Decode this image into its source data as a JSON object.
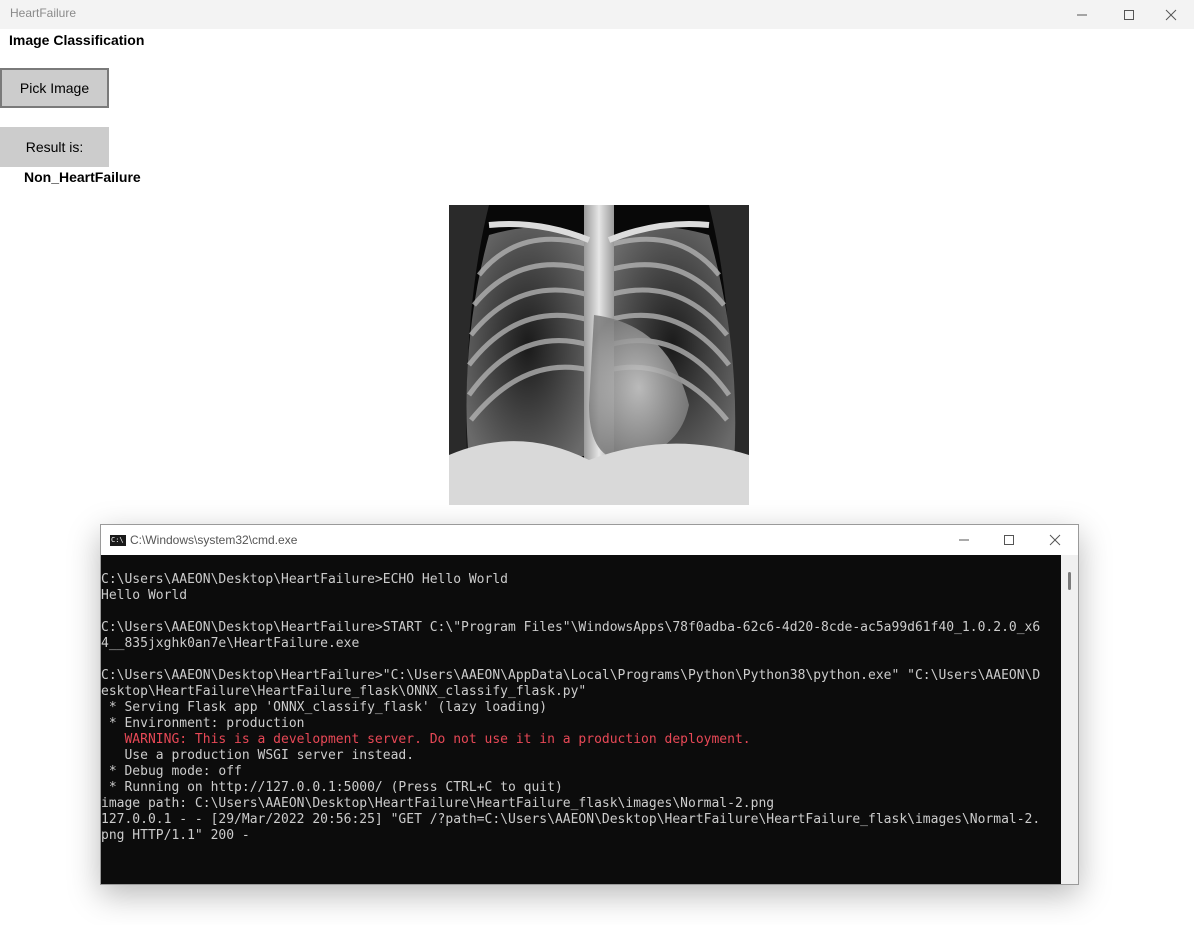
{
  "app": {
    "title": "HeartFailure",
    "heading": "Image Classification",
    "pick_button_label": "Pick Image",
    "result_label": "Result is:",
    "result_value": "Non_HeartFailure"
  },
  "icons": {
    "minimize": "minimize-icon",
    "maximize": "maximize-icon",
    "close": "close-icon",
    "console": "console-icon"
  },
  "cmd": {
    "title": "C:\\Windows\\system32\\cmd.exe",
    "icon_text": "C:\\",
    "lines": [
      {
        "text": "C:\\Users\\AAEON\\Desktop\\HeartFailure>ECHO Hello World",
        "style": "normal"
      },
      {
        "text": "Hello World",
        "style": "normal"
      },
      {
        "text": "",
        "style": "normal"
      },
      {
        "text": "C:\\Users\\AAEON\\Desktop\\HeartFailure>START C:\\\"Program Files\"\\WindowsApps\\78f0adba-62c6-4d20-8cde-ac5a99d61f40_1.0.2.0_x6",
        "style": "normal"
      },
      {
        "text": "4__835jxghk0an7e\\HeartFailure.exe",
        "style": "normal"
      },
      {
        "text": "",
        "style": "normal"
      },
      {
        "text": "C:\\Users\\AAEON\\Desktop\\HeartFailure>\"C:\\Users\\AAEON\\AppData\\Local\\Programs\\Python\\Python38\\python.exe\" \"C:\\Users\\AAEON\\D",
        "style": "normal"
      },
      {
        "text": "esktop\\HeartFailure\\HeartFailure_flask\\ONNX_classify_flask.py\"",
        "style": "normal"
      },
      {
        "text": " * Serving Flask app 'ONNX_classify_flask' (lazy loading)",
        "style": "normal"
      },
      {
        "text": " * Environment: production",
        "style": "normal"
      },
      {
        "text": "   WARNING: This is a development server. Do not use it in a production deployment.",
        "style": "warn"
      },
      {
        "text": "   Use a production WSGI server instead.",
        "style": "normal"
      },
      {
        "text": " * Debug mode: off",
        "style": "normal"
      },
      {
        "text": " * Running on http://127.0.0.1:5000/ (Press CTRL+C to quit)",
        "style": "normal"
      },
      {
        "text": "image path: C:\\Users\\AAEON\\Desktop\\HeartFailure\\HeartFailure_flask\\images\\Normal-2.png",
        "style": "normal"
      },
      {
        "text": "127.0.0.1 - - [29/Mar/2022 20:56:25] \"GET /?path=C:\\Users\\AAEON\\Desktop\\HeartFailure\\HeartFailure_flask\\images\\Normal-2.",
        "style": "normal"
      },
      {
        "text": "png HTTP/1.1\" 200 -",
        "style": "normal"
      }
    ]
  }
}
